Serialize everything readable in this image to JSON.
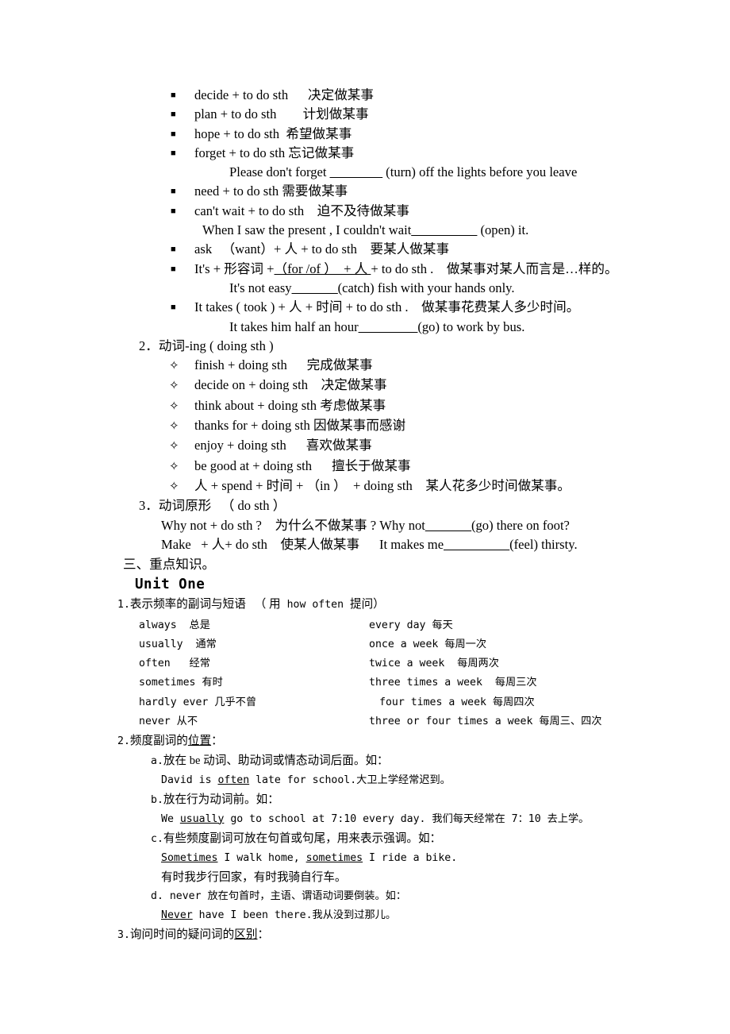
{
  "document": {
    "section_heading": "三、重点知识。",
    "unit_title": "Unit One"
  },
  "infinitive_list": {
    "marker": "■",
    "items": [
      {
        "pattern": "decide + to do sth",
        "gap": "  ",
        "meaning": "决定做某事"
      },
      {
        "pattern": "plan + to do sth",
        "gap": "  ",
        "meaning": "计划做某事"
      },
      {
        "pattern": "hope + to do sth",
        "gap": " ",
        "meaning": "希望做某事"
      },
      {
        "pattern": "forget + to do sth",
        "gap": " ",
        "meaning": "忘记做某事"
      },
      {
        "pattern": "need + to do sth",
        "gap": " ",
        "meaning": "需要做某事"
      },
      {
        "pattern": "can't wait + to do sth",
        "gap": " ",
        "meaning": "迫不及待做某事"
      }
    ],
    "example_forget": {
      "before": "Please don't forget ",
      "blank": "________",
      "after": " (turn) off the lights before you leave"
    },
    "example_cant_wait": {
      "before": "When I saw the present , I couldn't wait",
      "blank": "__________",
      "after": "  (open) it."
    },
    "ask_line": {
      "text": "ask  （want）+ 人 + to do sth  要某人做某事"
    },
    "its_adj_line": {
      "prefix": "It's + 形容词 +",
      "underlined": "（for /of ） + 人 ",
      "suffix": "+ to do sth .  做某事对某人而言是…样的。"
    },
    "example_not_easy": {
      "before": "It's not easy",
      "blank": "_______",
      "after": "(catch) fish with your hands only."
    },
    "it_takes_line": {
      "text": "It takes ( took ) + 人 + 时间 + to do sth .  做某事花费某人多少时间。"
    },
    "example_it_takes": {
      "before": "It takes him half an hour",
      "blank": "_________",
      "after": "(go) to work by bus."
    }
  },
  "gerund_section": {
    "number": "2．动词-ing ( doing sth )",
    "marker": "✧",
    "items": [
      {
        "pattern": "finish + doing sth",
        "gap": "  ",
        "meaning": "完成做某事"
      },
      {
        "pattern": "decide on + doing sth",
        "gap": "  ",
        "meaning": "决定做某事"
      },
      {
        "pattern": "think about + doing sth",
        "gap": " ",
        "meaning": "考虑做某事"
      },
      {
        "pattern": "thanks for + doing sth",
        "gap": " ",
        "meaning": "因做某事而感谢"
      },
      {
        "pattern": "enjoy + doing sth",
        "gap": "  ",
        "meaning": "喜欢做某事"
      },
      {
        "pattern": "be good at + doing sth",
        "gap": "  ",
        "meaning": "擅长于做某事"
      }
    ],
    "spend_line": "人 + spend + 时间 + （in ） + doing sth  某人花多少时间做某事。"
  },
  "base_form_section": {
    "number": "3．动词原形  （ do sth ）",
    "why_not": {
      "before": "Why not + do sth ?  为什么不做某事 ?  Why not",
      "blank": "_______",
      "after": "(go) there on foot?"
    },
    "make": {
      "before": "Make  + 人+ do sth  使某人做某事   It makes me",
      "blank": "__________",
      "after": "(feel) thirsty."
    }
  },
  "unit_one": {
    "item1": {
      "number": "1.",
      "text_before": "表示频率的副词与短语  （ 用",
      "how_often": " how often ",
      "text_after": "提问）"
    },
    "frequency_table": [
      {
        "left": "always  总是",
        "right": "every day 每天",
        "right_indent": false
      },
      {
        "left": "usually  通常",
        "right": "once a week 每周一次",
        "right_indent": false
      },
      {
        "left": "often   经常",
        "right": "twice a week  每周两次",
        "right_indent": false
      },
      {
        "left": "sometimes 有时",
        "right": "three times a week  每周三次",
        "right_indent": false
      },
      {
        "left": "hardly ever 几乎不曾",
        "right": "four times a week 每周四次",
        "right_indent": true
      },
      {
        "left": "never 从不",
        "right": "three or four times a week 每周三、四次",
        "right_indent": false
      }
    ],
    "item2": {
      "number": "2.",
      "before": "频度副词的",
      "underlined": "位置",
      "after": "："
    },
    "item2_points": [
      {
        "label": "a.",
        "text": "放在 be 动词、助动词或情态动词后面。如：",
        "example_before": "David is ",
        "example_underlined": "often",
        "example_after": " late for school.大卫上学经常迟到。"
      },
      {
        "label": "b.",
        "text": "放在行为动词前。如：",
        "example_before": "We ",
        "example_underlined": "usually",
        "example_after": " go to school at 7:10 every day. 我们每天经常在 7：10 去上学。"
      },
      {
        "label": "c.",
        "text": "有些频度副词可放在句首或句尾，用来表示强调。如：",
        "example_u1": "Sometimes",
        "example_mid": " I walk home, ",
        "example_u2": "sometimes",
        "example_end": " I ride a bike.",
        "translation": "有时我步行回家，有时我骑自行车。"
      },
      {
        "label": "d.",
        "text": " never 放在句首时，主语、谓语动词要倒装。如：",
        "example_underlined": "Never",
        "example_after": " have I been there.我从没到过那儿。"
      }
    ],
    "item3": {
      "number": "3.",
      "before": "询问时间的疑问词的",
      "underlined": "区别",
      "after": "："
    }
  }
}
